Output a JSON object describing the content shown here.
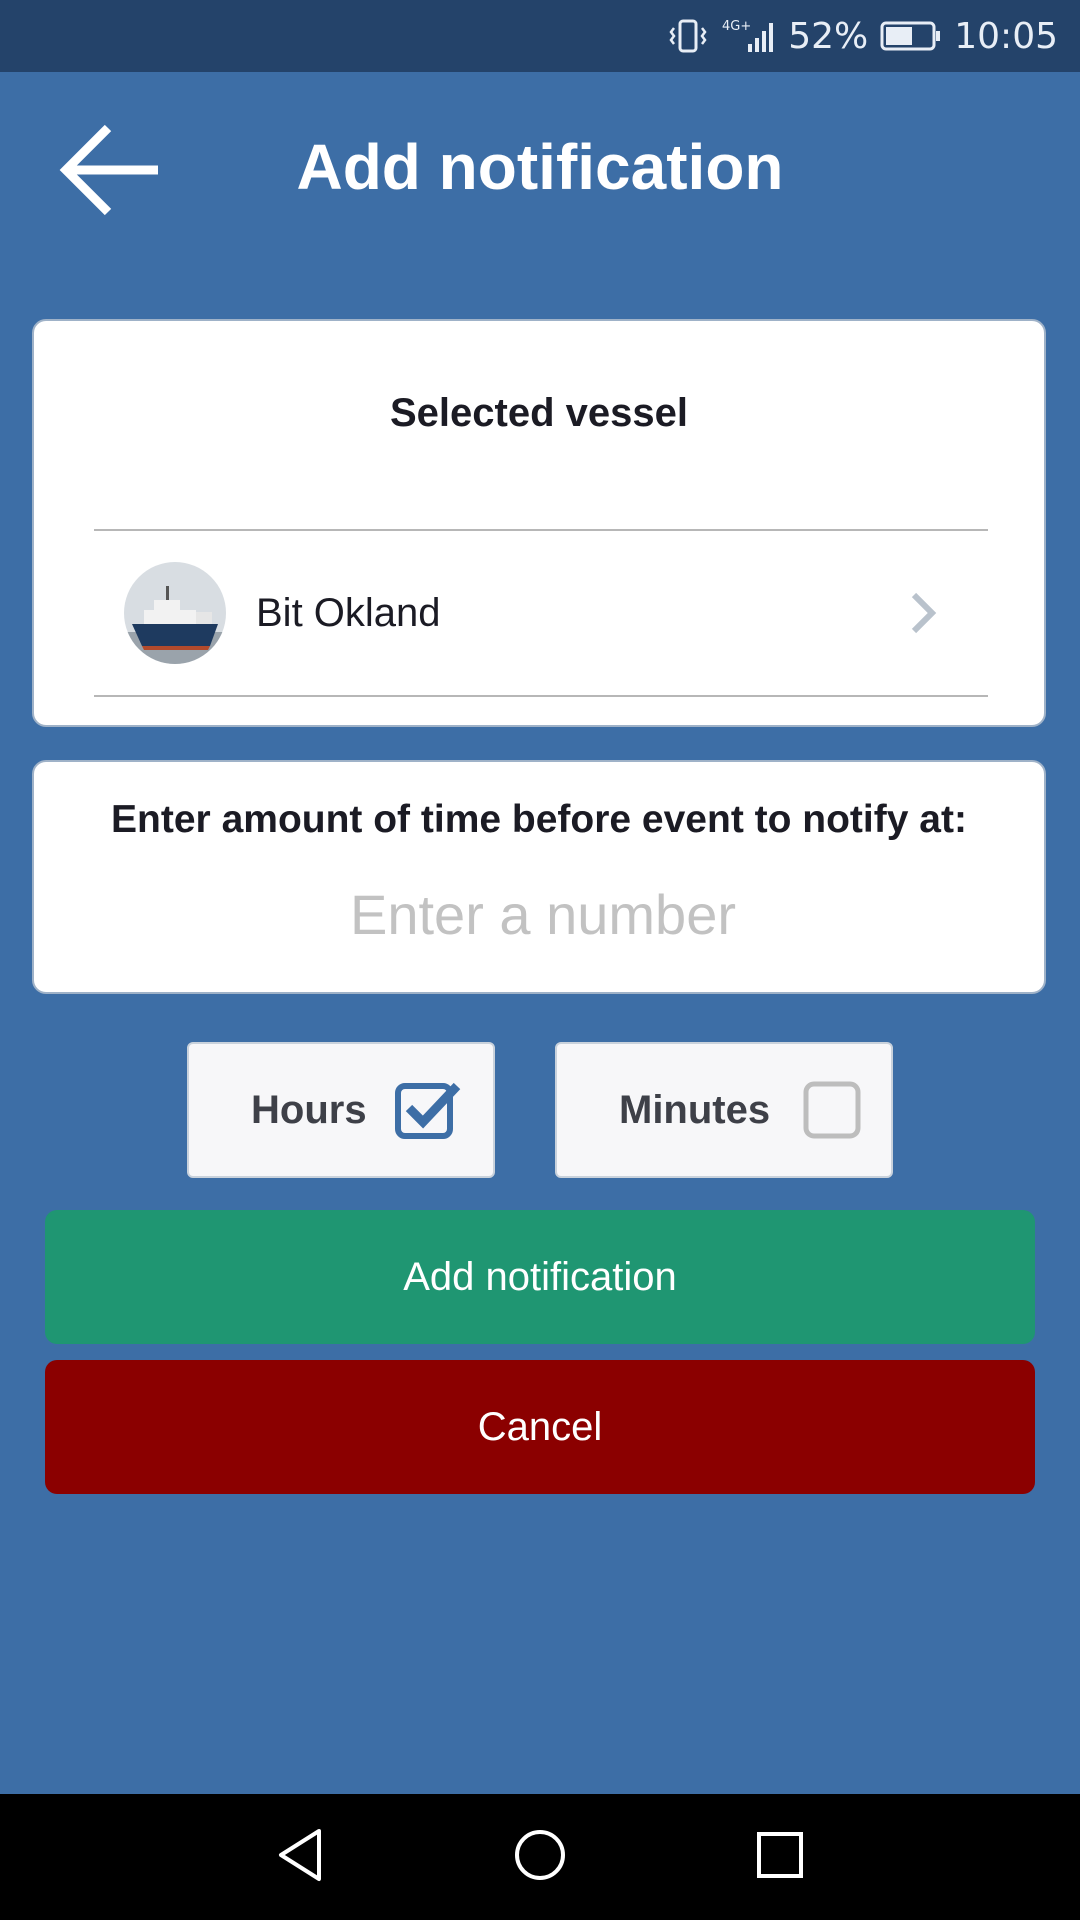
{
  "status_bar": {
    "network": "4G+",
    "battery_percent": "52%",
    "time": "10:05",
    "icons": [
      "vibrate-icon",
      "signal-icon",
      "battery-icon"
    ]
  },
  "header": {
    "title": "Add notification",
    "back_icon": "arrow-left-icon"
  },
  "vessel_card": {
    "heading": "Selected vessel",
    "vessel": {
      "name": "Bit Okland",
      "avatar_icon": "ship-photo",
      "chevron_icon": "chevron-right-icon"
    }
  },
  "time_card": {
    "label": "Enter amount of time before event to notify at:",
    "input_value": "",
    "input_placeholder": "Enter a number"
  },
  "units": [
    {
      "label": "Hours",
      "checked": true
    },
    {
      "label": "Minutes",
      "checked": false
    }
  ],
  "actions": {
    "add_label": "Add notification",
    "cancel_label": "Cancel"
  },
  "nav_bar": {
    "icons": [
      "nav-back-icon",
      "nav-home-icon",
      "nav-recent-icon"
    ]
  },
  "colors": {
    "background": "#3d6ea6",
    "status_bar": "#24436a",
    "add_button": "#1f9672",
    "cancel_button": "#8b0000",
    "checkbox_accent": "#3d6ea6"
  }
}
